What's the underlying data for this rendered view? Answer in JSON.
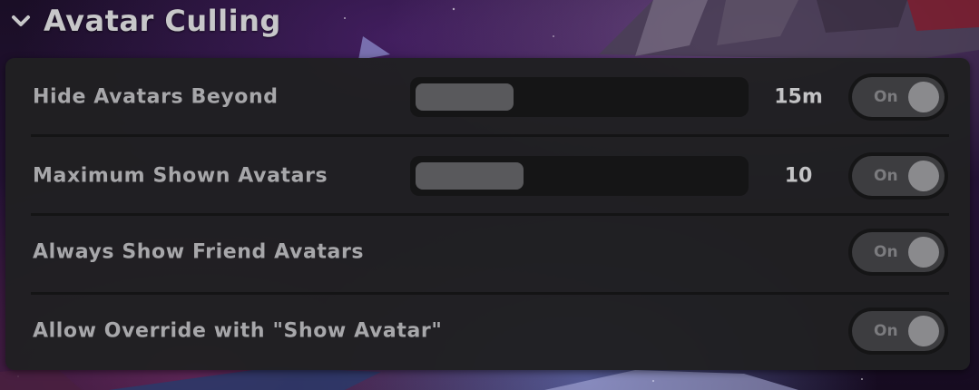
{
  "header": {
    "title": "Avatar Culling",
    "collapse_icon": "chevron-down-icon"
  },
  "colors": {
    "panel_bg": "#202022",
    "track_bg": "#151516",
    "fill": "#59595c",
    "label_text": "#a7a7aa",
    "toggle_knob": "#8a8a8d"
  },
  "settings": [
    {
      "label": "Hide Avatars Beyond",
      "value": "15m",
      "slider_fraction": 0.3,
      "toggle": "On"
    },
    {
      "label": "Maximum Shown Avatars",
      "value": "10",
      "slider_fraction": 0.33,
      "toggle": "On"
    },
    {
      "label": "Always Show Friend Avatars",
      "toggle": "On"
    },
    {
      "label": "Allow Override with \"Show Avatar\"",
      "toggle": "On"
    }
  ]
}
